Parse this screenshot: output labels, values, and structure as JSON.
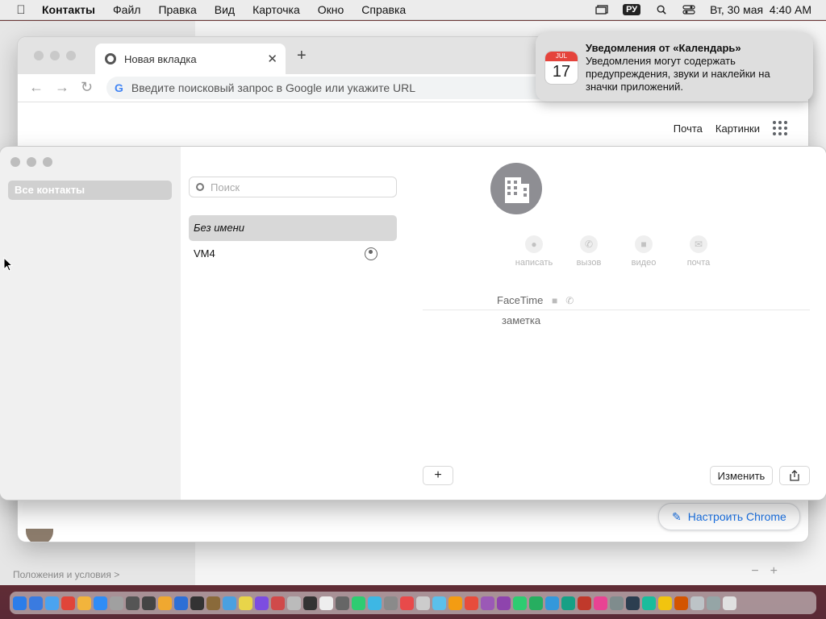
{
  "menubar": {
    "app_name": "Контакты",
    "items": [
      "Файл",
      "Правка",
      "Вид",
      "Карточка",
      "Окно",
      "Справка"
    ],
    "input_source": "РУ",
    "datetime": "Вт, 30 мая  4:40 AM"
  },
  "background_window": {
    "footer_text": "Положения и условия >"
  },
  "chrome": {
    "tab_title": "Новая вкладка",
    "omnibox_placeholder": "Введите поисковый запрос в Google или укажите URL",
    "links": [
      "Почта",
      "Картинки"
    ],
    "customize_label": "Настроить Chrome"
  },
  "notification": {
    "title": "Уведомления от «Календарь»",
    "body": "Уведомления могут содержать предупреждения, звуки и наклейки на значки приложений.",
    "icon_month": "JUL",
    "icon_day": "17"
  },
  "contacts": {
    "groups": [
      "Все контакты"
    ],
    "search_placeholder": "Поиск",
    "list": [
      "Без имени",
      "VM4"
    ],
    "actions": [
      "написать",
      "вызов",
      "видео",
      "почта"
    ],
    "fields": {
      "facetime_label": "FaceTime",
      "note_label": "заметка"
    },
    "add_button": "+",
    "edit_button": "Изменить"
  },
  "dock": {
    "icon_colors": [
      "#2b7de9",
      "#3a7be0",
      "#4aa3f0",
      "#e0453a",
      "#f2b43c",
      "#2f8cf5",
      "#a0a0a0",
      "#555",
      "#444",
      "#f0a830",
      "#2d6fd6",
      "#333",
      "#8a6a3a",
      "#4aa0e0",
      "#e8d54a",
      "#7c4de0",
      "#d04a4a",
      "#bbb",
      "#333",
      "#eee",
      "#666",
      "#2ecc71",
      "#3db7e4",
      "#8a8a8a",
      "#e84a4a",
      "#cccccc",
      "#5bc0eb",
      "#f39c12",
      "#e74c3c",
      "#9b59b6",
      "#8e44ad",
      "#2ecc71",
      "#27ae60",
      "#3498db",
      "#16a085",
      "#c0392b",
      "#e84393",
      "#7f8c8d",
      "#2c3e50",
      "#1abc9c",
      "#f1c40f",
      "#d35400",
      "#bdc3c7",
      "#95a5a6",
      "#e0e0e0"
    ]
  }
}
